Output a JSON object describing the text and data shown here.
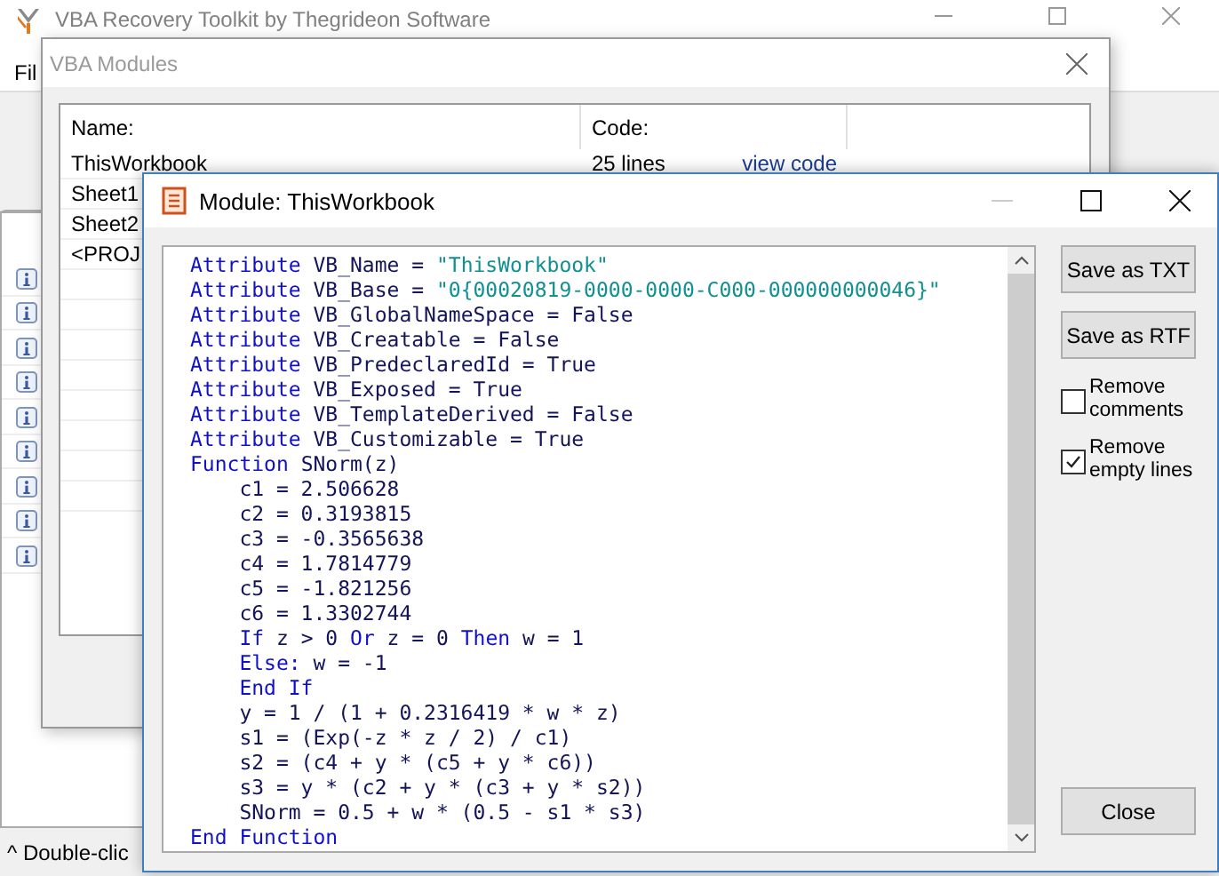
{
  "main_window": {
    "title": "VBA Recovery Toolkit by Thegrideon Software",
    "menu": [
      "Fil"
    ],
    "status_text": "^ Double-clic"
  },
  "modules_window": {
    "title": "VBA Modules",
    "columns": [
      "Name:",
      "Code:"
    ],
    "rows": [
      {
        "name": "ThisWorkbook",
        "code": "25 lines",
        "link": "view code"
      },
      {
        "name": "Sheet1"
      },
      {
        "name": "Sheet2"
      },
      {
        "name": "<PROJ"
      }
    ]
  },
  "module_window": {
    "title": "Module: ThisWorkbook",
    "code_lines": [
      {
        "indented": false,
        "tokens": [
          {
            "kind": "keyword",
            "text": "Attribute"
          },
          {
            "kind": "plain",
            "text": "VB_Name ="
          },
          {
            "kind": "string",
            "text": "\"ThisWorkbook\""
          }
        ]
      },
      {
        "indented": false,
        "tokens": [
          {
            "kind": "keyword",
            "text": "Attribute"
          },
          {
            "kind": "plain",
            "text": "VB_Base ="
          },
          {
            "kind": "string",
            "text": "\"0{00020819-0000-0000-C000-000000000046}\""
          }
        ]
      },
      {
        "indented": false,
        "tokens": [
          {
            "kind": "keyword",
            "text": "Attribute"
          },
          {
            "kind": "plain",
            "text": "VB_GlobalNameSpace = False"
          }
        ]
      },
      {
        "indented": false,
        "tokens": [
          {
            "kind": "keyword",
            "text": "Attribute"
          },
          {
            "kind": "plain",
            "text": "VB_Creatable = False"
          }
        ]
      },
      {
        "indented": false,
        "tokens": [
          {
            "kind": "keyword",
            "text": "Attribute"
          },
          {
            "kind": "plain",
            "text": "VB_PredeclaredId = True"
          }
        ]
      },
      {
        "indented": false,
        "tokens": [
          {
            "kind": "keyword",
            "text": "Attribute"
          },
          {
            "kind": "plain",
            "text": "VB_Exposed = True"
          }
        ]
      },
      {
        "indented": false,
        "tokens": [
          {
            "kind": "keyword",
            "text": "Attribute"
          },
          {
            "kind": "plain",
            "text": "VB_TemplateDerived = False"
          }
        ]
      },
      {
        "indented": false,
        "tokens": [
          {
            "kind": "keyword",
            "text": "Attribute"
          },
          {
            "kind": "plain",
            "text": "VB_Customizable = True"
          }
        ]
      },
      {
        "indented": false,
        "tokens": [
          {
            "kind": "keyword",
            "text": "Function"
          },
          {
            "kind": "plain",
            "text": "SNorm(z)"
          }
        ]
      },
      {
        "indented": true,
        "tokens": [
          {
            "kind": "plain",
            "text": "c1 = 2.506628"
          }
        ]
      },
      {
        "indented": true,
        "tokens": [
          {
            "kind": "plain",
            "text": "c2 = 0.3193815"
          }
        ]
      },
      {
        "indented": true,
        "tokens": [
          {
            "kind": "plain",
            "text": "c3 = -0.3565638"
          }
        ]
      },
      {
        "indented": true,
        "tokens": [
          {
            "kind": "plain",
            "text": "c4 = 1.7814779"
          }
        ]
      },
      {
        "indented": true,
        "tokens": [
          {
            "kind": "plain",
            "text": "c5 = -1.821256"
          }
        ]
      },
      {
        "indented": true,
        "tokens": [
          {
            "kind": "plain",
            "text": "c6 = 1.3302744"
          }
        ]
      },
      {
        "indented": true,
        "tokens": [
          {
            "kind": "keyword",
            "text": "If"
          },
          {
            "kind": "plain",
            "text": "z > 0"
          },
          {
            "kind": "keyword",
            "text": "Or"
          },
          {
            "kind": "plain",
            "text": "z = 0"
          },
          {
            "kind": "keyword",
            "text": "Then"
          },
          {
            "kind": "plain",
            "text": "w = 1"
          }
        ]
      },
      {
        "indented": true,
        "tokens": [
          {
            "kind": "keyword",
            "text": "Else:"
          },
          {
            "kind": "plain",
            "text": "w = -1"
          }
        ]
      },
      {
        "indented": true,
        "tokens": [
          {
            "kind": "keyword",
            "text": "End If"
          }
        ]
      },
      {
        "indented": true,
        "tokens": [
          {
            "kind": "plain",
            "text": "y = 1 / (1 + 0.2316419 * w * z)"
          }
        ]
      },
      {
        "indented": true,
        "tokens": [
          {
            "kind": "plain",
            "text": "s1 = (Exp(-z * z / 2) / c1)"
          }
        ]
      },
      {
        "indented": true,
        "tokens": [
          {
            "kind": "plain",
            "text": "s2 = (c4 + y * (c5 + y * c6))"
          }
        ]
      },
      {
        "indented": true,
        "tokens": [
          {
            "kind": "plain",
            "text": "s3 = y * (c2 + y * (c3 + y * s2))"
          }
        ]
      },
      {
        "indented": true,
        "tokens": [
          {
            "kind": "plain",
            "text": "SNorm = 0.5 + w * (0.5 - s1 * s3)"
          }
        ]
      },
      {
        "indented": false,
        "tokens": [
          {
            "kind": "keyword",
            "text": "End Function"
          }
        ]
      }
    ],
    "buttons": [
      "Save as TXT",
      "Save as RTF"
    ],
    "options": [
      {
        "label": "Remove comments",
        "checked": false
      },
      {
        "label": "Remove empty lines",
        "checked": true
      }
    ],
    "close_button": "Close"
  }
}
